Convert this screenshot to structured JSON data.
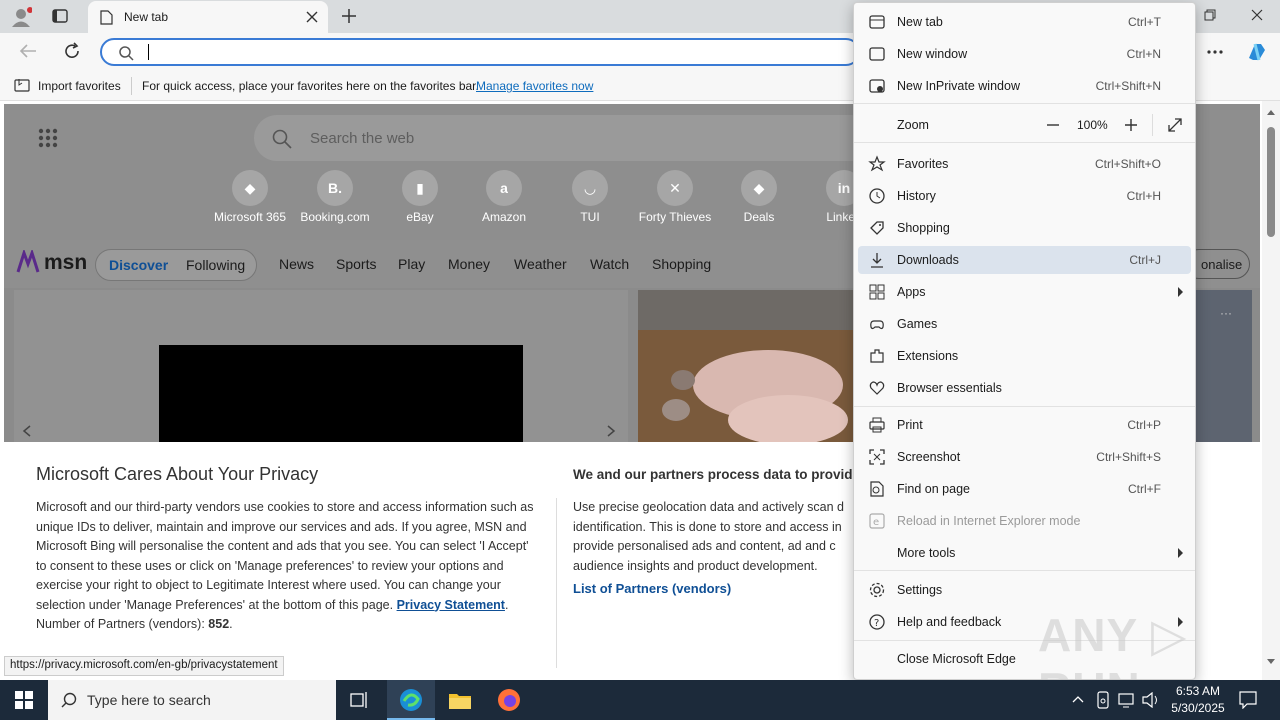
{
  "browser": {
    "tab_title": "New tab",
    "address_value": "",
    "favorites_bar": {
      "import_label": "Import favorites",
      "hint": "For quick access, place your favorites here on the favorites bar.",
      "manage_link": "Manage favorites now"
    }
  },
  "ntp": {
    "search_placeholder": "Search the web",
    "quick_links": [
      {
        "label": "Microsoft 365",
        "icon": "microsoft365-icon",
        "glyph": "◆"
      },
      {
        "label": "Booking.com",
        "icon": "booking-icon",
        "glyph": "B."
      },
      {
        "label": "eBay",
        "icon": "ebay-icon",
        "glyph": "▮"
      },
      {
        "label": "Amazon",
        "icon": "amazon-icon",
        "glyph": "a"
      },
      {
        "label": "TUI",
        "icon": "tui-icon",
        "glyph": "◡"
      },
      {
        "label": "Forty Thieves",
        "icon": "forty-thieves-icon",
        "glyph": "✕"
      },
      {
        "label": "Deals",
        "icon": "deals-icon",
        "glyph": "◆"
      },
      {
        "label": "Linked",
        "icon": "linkedin-icon",
        "glyph": "in"
      }
    ],
    "msn": {
      "logo": "msn",
      "tabs": [
        "Discover",
        "Following"
      ],
      "nav": [
        "News",
        "Sports",
        "Play",
        "Money",
        "Weather",
        "Watch",
        "Shopping"
      ],
      "personalise": "onalise"
    }
  },
  "privacy": {
    "title": "Microsoft Cares About Your Privacy",
    "body": "Microsoft and our third-party vendors use cookies to store and access information such as unique IDs to deliver, maintain and improve our services and ads. If you agree, MSN and Microsoft Bing will personalise the content and ads that you see. You can select 'I Accept' to consent to these uses or click on 'Manage preferences' to review your options and exercise your right to object to Legitimate Interest where used.  You can change your selection under 'Manage Preferences' at the bottom of this page.",
    "statement_link": "Privacy Statement",
    "partners_label": "Number of Partners (vendors):",
    "partners_count": "852",
    "right_title": "We and our partners process data to provide:",
    "right_body": "Use precise geolocation data and actively scan d identification. This is done to store and access in provide personalised ads and content, ad and c audience insights and product development.",
    "list_partners": "List of Partners (vendors)"
  },
  "status_url": "https://privacy.microsoft.com/en-gb/privacystatement",
  "menu": {
    "items": [
      {
        "label": "New tab",
        "shortcut": "Ctrl+T",
        "icon": "new-tab-icon"
      },
      {
        "label": "New window",
        "shortcut": "Ctrl+N",
        "icon": "new-window-icon"
      },
      {
        "label": "New InPrivate window",
        "shortcut": "Ctrl+Shift+N",
        "icon": "inprivate-icon"
      },
      {
        "label": "Zoom",
        "zoom_value": "100%"
      },
      {
        "label": "Favorites",
        "shortcut": "Ctrl+Shift+O",
        "icon": "favorites-icon"
      },
      {
        "label": "History",
        "shortcut": "Ctrl+H",
        "icon": "history-icon"
      },
      {
        "label": "Shopping",
        "shortcut": "",
        "icon": "shopping-icon"
      },
      {
        "label": "Downloads",
        "shortcut": "Ctrl+J",
        "icon": "downloads-icon"
      },
      {
        "label": "Apps",
        "shortcut": "",
        "icon": "apps-icon"
      },
      {
        "label": "Games",
        "shortcut": "",
        "icon": "games-icon"
      },
      {
        "label": "Extensions",
        "shortcut": "",
        "icon": "extensions-icon"
      },
      {
        "label": "Browser essentials",
        "shortcut": "",
        "icon": "browser-essentials-icon"
      },
      {
        "label": "Print",
        "shortcut": "Ctrl+P",
        "icon": "print-icon"
      },
      {
        "label": "Screenshot",
        "shortcut": "Ctrl+Shift+S",
        "icon": "screenshot-icon"
      },
      {
        "label": "Find on page",
        "shortcut": "Ctrl+F",
        "icon": "find-icon"
      },
      {
        "label": "Reload in Internet Explorer mode",
        "shortcut": "",
        "icon": "ie-mode-icon"
      },
      {
        "label": "More tools",
        "shortcut": ""
      },
      {
        "label": "Settings",
        "shortcut": "",
        "icon": "settings-icon"
      },
      {
        "label": "Help and feedback",
        "shortcut": "",
        "icon": "help-icon"
      },
      {
        "label": "Close Microsoft Edge",
        "shortcut": ""
      }
    ]
  },
  "taskbar": {
    "search_placeholder": "Type here to search",
    "time": "6:53 AM",
    "date": "5/30/2025"
  },
  "watermark": "ANY RUN",
  "colors": {
    "accent": "#0f6cbd",
    "selected": "#dbe3ed",
    "taskbar": "#1c2a3a"
  }
}
